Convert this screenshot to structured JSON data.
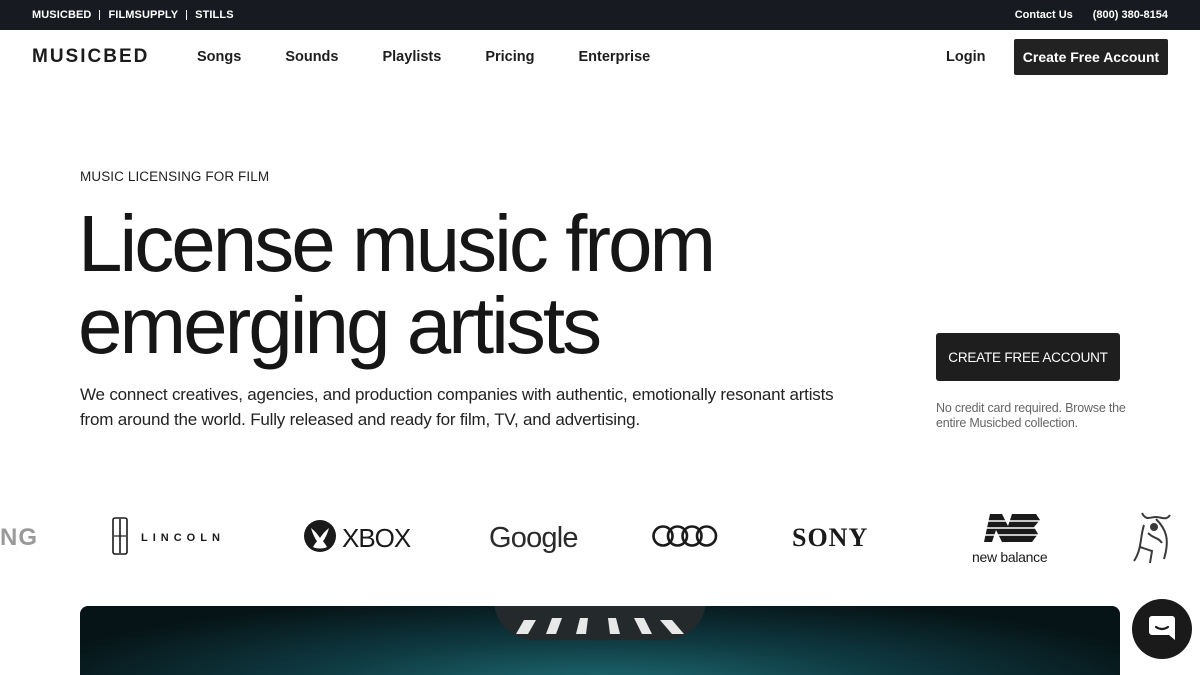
{
  "topbar": {
    "brands": [
      "MUSICBED",
      "FILMSUPPLY",
      "STILLS"
    ],
    "contact": "Contact Us",
    "phone": "(800) 380-8154"
  },
  "nav": {
    "logo": "MUSICBED",
    "items": [
      "Songs",
      "Sounds",
      "Playlists",
      "Pricing",
      "Enterprise"
    ],
    "login": "Login",
    "cta": "Create Free Account"
  },
  "hero": {
    "eyebrow": "MUSIC LICENSING FOR FILM",
    "headline": "License music from emerging artists",
    "subtext": "We connect creatives, agencies, and production companies with authentic, emotionally resonant artists from around the world. Fully released and ready for film, TV, and advertising.",
    "cta": "CREATE FREE ACCOUNT",
    "cta_note": "No credit card required. Browse the entire Musicbed collection."
  },
  "logos": {
    "partial_left": "NG",
    "lincoln": "LINCOLN",
    "xbox": "XBOX",
    "google": "Google",
    "sony": "SONY",
    "new_balance": "new balance"
  },
  "icons": {
    "audi": "audi-rings-icon",
    "xbox": "xbox-sphere-icon",
    "lincoln": "lincoln-star-icon",
    "new_balance": "nb-monogram-icon",
    "bull": "bull-icon",
    "chat": "chat-icon"
  }
}
